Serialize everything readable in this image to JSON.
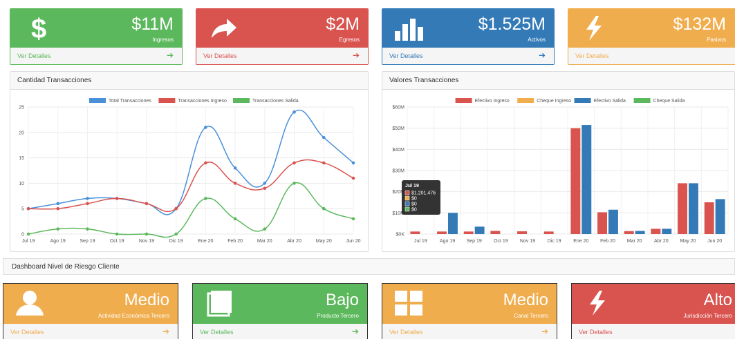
{
  "stats": [
    {
      "value": "$11M",
      "label": "Ingresos",
      "link": "Ver Detalles",
      "icon": "dollar-icon"
    },
    {
      "value": "$2M",
      "label": "Egresos",
      "link": "Ver Detalles",
      "icon": "share-arrow-icon"
    },
    {
      "value": "$1.525M",
      "label": "Activos",
      "link": "Ver Detalles",
      "icon": "bar-chart-icon"
    },
    {
      "value": "$132M",
      "label": "Pasivos",
      "link": "Ver Detalles",
      "icon": "bolt-icon"
    }
  ],
  "panels": {
    "line_title": "Cantidad Transacciones",
    "bar_title": "Valores Transacciones"
  },
  "risk": {
    "title": "Dashboard Nivel de Riesgo Cliente",
    "cards": [
      {
        "value": "Medio",
        "label": "Actividad Económica Tercero",
        "link": "Ver Detalles",
        "icon": "user-icon"
      },
      {
        "value": "Bajo",
        "label": "Producto Tercero",
        "link": "Ver Detalles",
        "icon": "book-icon"
      },
      {
        "value": "Medio",
        "label": "Canal Tercero",
        "link": "Ver Detalles",
        "icon": "grid-icon"
      },
      {
        "value": "Alto",
        "label": "Jurisdicción Tercero",
        "link": "Ver Detalles",
        "icon": "bolt-icon"
      }
    ]
  },
  "colors": {
    "green": "#5cb85c",
    "red": "#d9534f",
    "blue": "#337ab7",
    "orange": "#f0ad4e",
    "line_blue": "#4a90d9"
  },
  "tooltip": {
    "title": "Jul 19",
    "rows": [
      "$1.201.476",
      "$0",
      "$0",
      "$0"
    ]
  },
  "chart_data": [
    {
      "type": "line",
      "title": "Cantidad Transacciones",
      "categories": [
        "Jul 19",
        "Ago 19",
        "Sep 19",
        "Oct 19",
        "Nov 19",
        "Dic 19",
        "Ene 20",
        "Feb 20",
        "Mar 20",
        "Abr 20",
        "May 20",
        "Jun 20"
      ],
      "ylim": [
        0,
        25
      ],
      "yticks": [
        "0",
        "5",
        "10",
        "15",
        "20",
        "25"
      ],
      "legend": "top",
      "grid": true,
      "series": [
        {
          "name": "Total Transacciones",
          "color": "#4a90d9",
          "values": [
            5,
            6,
            7,
            7,
            6,
            5,
            21,
            13,
            10,
            24,
            19,
            14
          ]
        },
        {
          "name": "Transacciones Ingreso",
          "color": "#d9534f",
          "values": [
            5,
            5,
            6,
            7,
            6,
            5,
            14,
            10,
            9,
            14,
            14,
            11
          ]
        },
        {
          "name": "Transacciones Salida",
          "color": "#5cb85c",
          "values": [
            0,
            1,
            1,
            0,
            0,
            0,
            7,
            3,
            1,
            10,
            5,
            3
          ]
        }
      ]
    },
    {
      "type": "bar",
      "title": "Valores Transacciones",
      "categories": [
        "Jul 19",
        "Ago 19",
        "Sep 19",
        "Oct 19",
        "Nov 19",
        "Dic 19",
        "Ene 20",
        "Feb 20",
        "Mar 20",
        "Abr 20",
        "May 20",
        "Jun 20"
      ],
      "ylim": [
        0,
        60
      ],
      "yticks": [
        "$0K",
        "$10M",
        "$20M",
        "$30M",
        "$40M",
        "$50M",
        "$60M"
      ],
      "legend": "top",
      "grid": true,
      "series": [
        {
          "name": "Efectivo Ingreso",
          "color": "#d9534f",
          "values": [
            1.2,
            1.2,
            1.2,
            1.5,
            1.3,
            1.2,
            50,
            10.3,
            1.4,
            2.5,
            24,
            15
          ]
        },
        {
          "name": "Cheque Ingreso",
          "color": "#f0ad4e",
          "values": [
            0,
            0,
            0,
            0,
            0,
            0,
            0,
            0,
            0,
            0,
            0,
            0
          ]
        },
        {
          "name": "Efectivo Salida",
          "color": "#337ab7",
          "values": [
            0,
            10,
            3.5,
            0,
            0,
            0,
            51.5,
            11.5,
            1.5,
            2.5,
            24,
            16.5
          ]
        },
        {
          "name": "Cheque Salida",
          "color": "#5cb85c",
          "values": [
            0,
            0,
            0,
            0,
            0,
            0,
            0,
            0,
            0,
            0,
            0,
            0
          ]
        }
      ]
    }
  ]
}
